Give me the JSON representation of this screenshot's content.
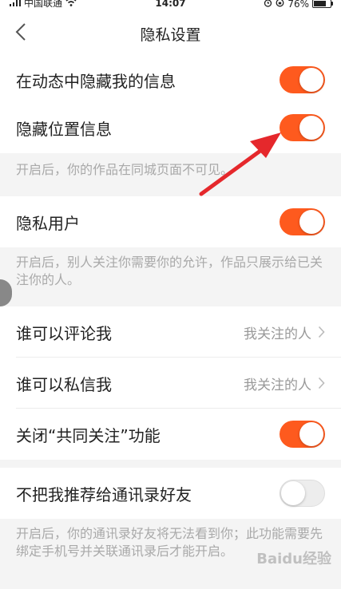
{
  "status_bar": {
    "carrier": "中国联通",
    "time": "14:07",
    "battery": "76%",
    "battery_level": 0.76,
    "icons": [
      "signal-icon",
      "wifi-icon",
      "alarm-icon",
      "orientation-lock-icon",
      "battery-icon"
    ]
  },
  "nav": {
    "title": "隐私设置",
    "back_icon": "chevron-left-icon"
  },
  "settings": {
    "hide_in_feed": {
      "label": "在动态中隐藏我的信息",
      "enabled": true
    },
    "hide_location": {
      "label": "隐藏位置信息",
      "enabled": true
    },
    "hide_location_note": "开启后，你的作品在同城页面不可见。",
    "private_user": {
      "label": "隐私用户",
      "enabled": true
    },
    "private_user_note": "开启后，别人关注你需要你的允许，作品只展示给已关注你的人。",
    "who_can_comment": {
      "label": "谁可以评论我",
      "value": "我关注的人"
    },
    "who_can_message": {
      "label": "谁可以私信我",
      "value": "我关注的人"
    },
    "mutual_follow": {
      "label": "关闭“共同关注”功能",
      "enabled": true
    },
    "recommend_contacts": {
      "label": "不把我推荐给通讯录好友",
      "enabled": false
    },
    "recommend_contacts_note": "开启后，你的通讯录好友将无法看到你；此功能需要先绑定手机号并关联通讯录后才能开启。"
  },
  "colors": {
    "toggle_on": "#fe5a1e",
    "toggle_off": "#ededed",
    "annotation_arrow": "#e5282c"
  },
  "watermark": "Baidu经验"
}
